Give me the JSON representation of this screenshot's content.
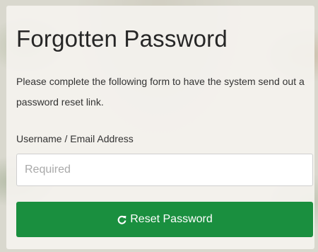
{
  "form": {
    "title": "Forgotten Password",
    "description": "Please complete the following form to have the system send out a password reset link.",
    "username_label": "Username / Email Address",
    "username_placeholder": "Required",
    "username_value": "",
    "submit_label": "Reset Password",
    "submit_icon": "refresh-icon"
  },
  "colors": {
    "button_background": "#1a8f3f",
    "button_text": "#ffffff",
    "panel_background": "#f4f2ee"
  }
}
